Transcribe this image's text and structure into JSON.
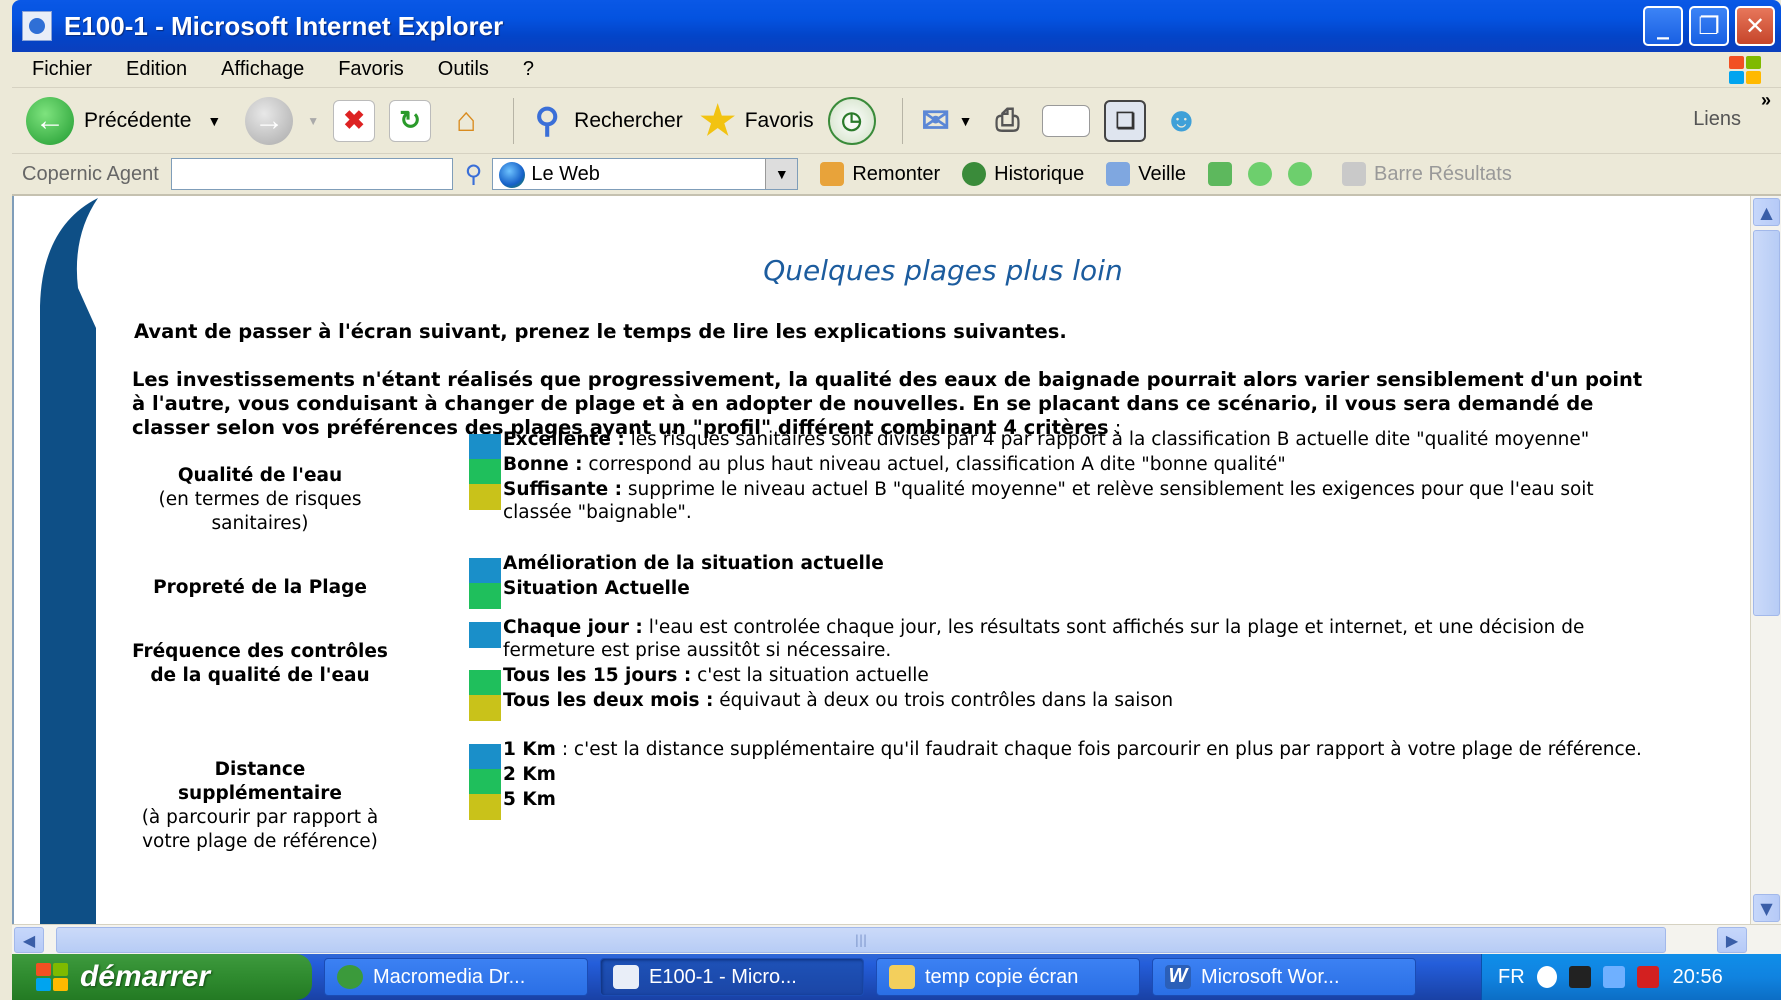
{
  "window": {
    "title": "E100-1 - Microsoft Internet Explorer",
    "minimize": "_",
    "maximize": "❐",
    "close": "✕"
  },
  "menu": [
    "Fichier",
    "Edition",
    "Affichage",
    "Favoris",
    "Outils",
    "?"
  ],
  "toolbar": {
    "back": "Précédente",
    "search": "Rechercher",
    "favorites": "Favoris",
    "links": "Liens",
    "chevron": "»"
  },
  "copernic": {
    "label": "Copernic Agent",
    "search_value": "",
    "scope": "Le Web",
    "remonter": "Remonter",
    "historique": "Historique",
    "veille": "Veille",
    "barre": "Barre Résultats"
  },
  "page": {
    "heading": "Quelques plages plus loin",
    "intro": "Avant de passer à l'écran suivant, prenez le temps de lire les explications suivantes.",
    "para_bold": "Les investissements n'étant réalisés que progressivement, la qualité des eaux de baignade pourrait alors varier sensiblement d'un point à l'autre, vous conduisant à changer de plage et à en adopter de nouvelles. En se placant dans ce scénario, il vous sera demandé de classer selon vos préférences des plages ayant un \"profil\" différent combinant 4 critères",
    "para_end": " :",
    "criteria": [
      {
        "title": "Qualité de l'eau",
        "subtitle": "(en termes de risques sanitaires)",
        "options": [
          {
            "label": "Excellente :",
            "text": " les risques sanitaires sont divisés par 4 par rapport à la classification B actuelle dite \"qualité moyenne\"",
            "color": "#1a8fc9"
          },
          {
            "label": "Bonne :",
            "text": " correspond au plus haut niveau actuel, classification A dite \"bonne qualité\"",
            "color": "#1fbf5c"
          },
          {
            "label": "Suffisante :",
            "text": " supprime le niveau actuel B \"qualité moyenne\" et relève sensiblement les exigences pour que l'eau soit classée \"baignable\".",
            "color": "#c9c21a"
          }
        ]
      },
      {
        "title": "Propreté de la Plage",
        "subtitle": "",
        "options": [
          {
            "label": "Amélioration de la situation actuelle",
            "text": "",
            "color": "#1a8fc9"
          },
          {
            "label": "Situation Actuelle",
            "text": "",
            "color": "#1fbf5c"
          }
        ]
      },
      {
        "title": "Fréquence des contrôles de la qualité de l'eau",
        "subtitle": "",
        "options": [
          {
            "label": "Chaque jour :",
            "text": " l'eau est controlée chaque jour, les résultats sont affichés sur la plage et internet, et une décision de fermeture est prise aussitôt si nécessaire.",
            "color": "#1a8fc9"
          },
          {
            "label": "Tous les 15 jours :",
            "text": " c'est la situation actuelle",
            "color": "#1fbf5c"
          },
          {
            "label": "Tous les deux mois :",
            "text": " équivaut à deux ou trois contrôles dans la saison",
            "color": "#c9c21a"
          }
        ]
      },
      {
        "title": "Distance supplémentaire",
        "subtitle": "(à parcourir par rapport à votre plage de référence)",
        "options": [
          {
            "label": "1 Km",
            "text": " : c'est la distance supplémentaire qu'il faudrait chaque fois parcourir en plus par rapport à votre plage de référence.",
            "color": "#1a8fc9"
          },
          {
            "label": "2 Km",
            "text": "",
            "color": "#1fbf5c"
          },
          {
            "label": "5 Km",
            "text": "",
            "color": "#c9c21a"
          }
        ]
      }
    ]
  },
  "scroll": {
    "up": "▲",
    "down": "▼",
    "left": "◀",
    "right": "▶",
    "grip": "|||"
  },
  "taskbar": {
    "start": "démarrer",
    "tasks": [
      "Macromedia Dr...",
      "E100-1 - Micro...",
      "temp copie écran",
      "Microsoft Wor..."
    ],
    "lang": "FR",
    "clock": "20:56"
  },
  "colors": {
    "accent": "#0453e0",
    "heading": "#1c5c9e",
    "swoosh": "#0e4f86"
  }
}
